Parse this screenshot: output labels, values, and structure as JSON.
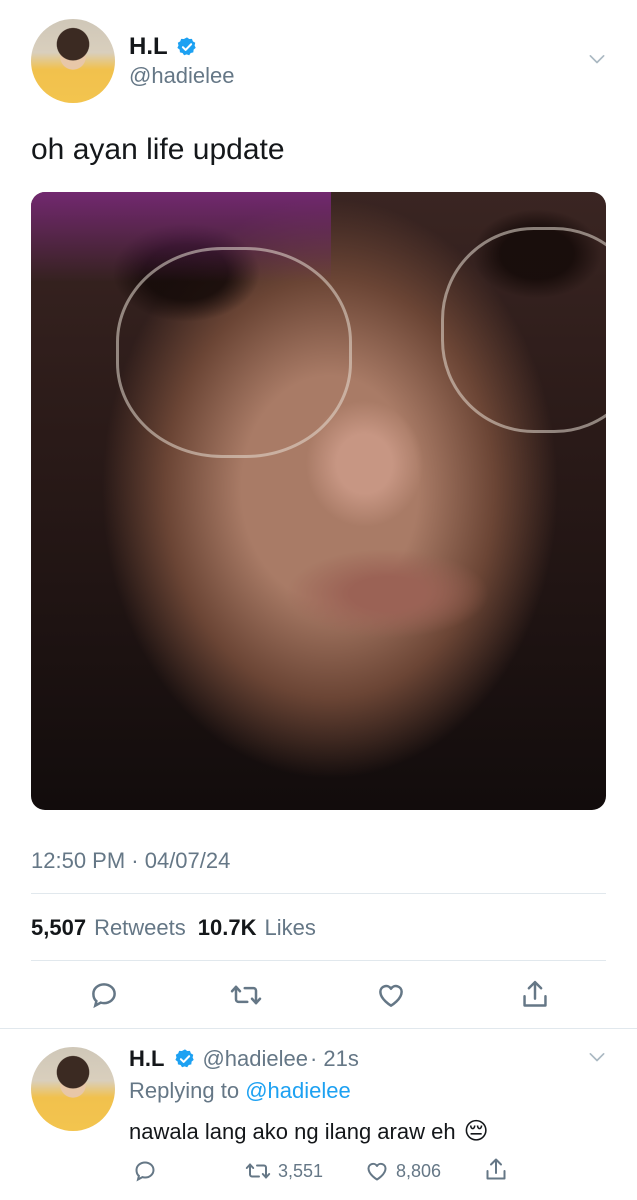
{
  "tweet": {
    "author_name": "H.L",
    "author_handle": "@hadielee",
    "text": "oh ayan life update",
    "timestamp": "12:50 PM · 04/07/24",
    "retweets_count": "5,507",
    "retweets_label": "Retweets",
    "likes_count": "10.7K",
    "likes_label": "Likes"
  },
  "reply": {
    "author_name": "H.L",
    "author_handle": "@hadielee",
    "time": "· 21s",
    "replying_prefix": "Replying to",
    "replying_to": "@hadielee",
    "text": "nawala lang ako ng ilang araw eh",
    "emoji": "😔",
    "retweet_count": "3,551",
    "like_count": "8,806"
  },
  "icons": {
    "verified": "verified-badge-icon",
    "reply": "reply-icon",
    "retweet": "retweet-icon",
    "like": "heart-icon",
    "share": "share-icon",
    "chevron": "chevron-down-icon"
  },
  "colors": {
    "accent": "#1da1f2",
    "secondary_text": "#657786",
    "divider": "#e1e8ed"
  }
}
